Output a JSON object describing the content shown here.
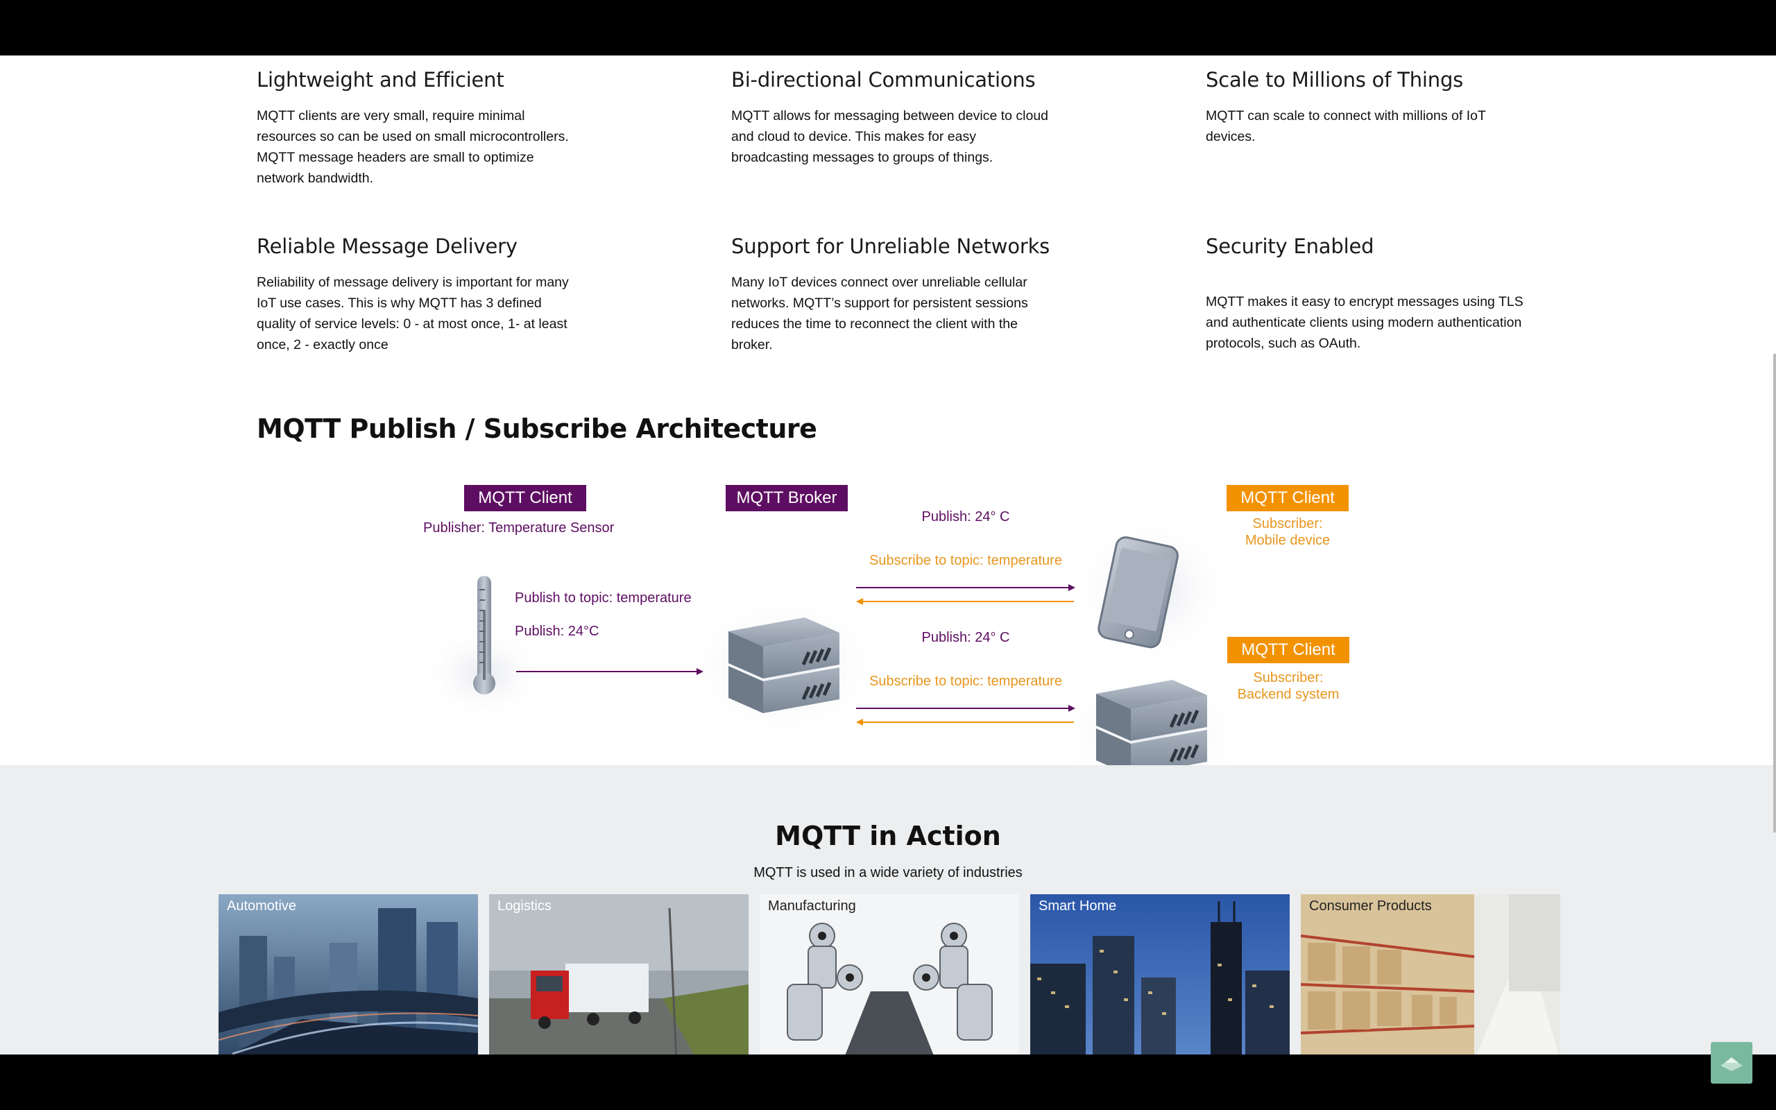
{
  "features": [
    {
      "title": "Lightweight and Efficient",
      "text": "MQTT clients are very small, require minimal resources so can be used on small microcontrollers. MQTT message headers are small to optimize network bandwidth."
    },
    {
      "title": "Bi-directional Communications",
      "text": "MQTT allows for messaging between device to cloud and cloud to device. This makes for easy broadcasting messages to groups of things."
    },
    {
      "title": "Scale to Millions of Things",
      "text": "MQTT can scale to connect with millions of IoT devices."
    },
    {
      "title": "Reliable Message Delivery",
      "text": "Reliability of message delivery is important for many IoT use cases. This is why MQTT has 3 defined quality of service levels: 0 - at most once, 1- at least once, 2 - exactly once"
    },
    {
      "title": "Support for Unreliable Networks",
      "text": "Many IoT devices connect over unreliable cellular networks. MQTT’s support for persistent sessions reduces the time to reconnect the client with the broker."
    },
    {
      "title": "Security Enabled",
      "text": "MQTT makes it easy to encrypt messages using TLS and authenticate clients using modern authentication protocols, such as OAuth."
    }
  ],
  "architecture": {
    "title": "MQTT Publish / Subscribe Architecture",
    "publisher_tag": "MQTT Client",
    "publisher_label": "Publisher: Temperature Sensor",
    "publish_topic": "Publish to topic: temperature",
    "publish_value": "Publish: 24°C",
    "broker_tag": "MQTT Broker",
    "top_publish": "Publish: 24° C",
    "top_subscribe": "Subscribe to topic: temperature",
    "bottom_publish": "Publish: 24° C",
    "bottom_subscribe": "Subscribe to topic: temperature",
    "mobile_tag": "MQTT Client",
    "mobile_sub_line1": "Subscriber:",
    "mobile_sub_line2": "Mobile device",
    "backend_tag": "MQTT Client",
    "backend_sub_line1": "Subscriber:",
    "backend_sub_line2": "Backend system"
  },
  "action": {
    "title": "MQTT in Action",
    "subtitle": "MQTT is used in a wide variety of industries",
    "tiles": [
      "Automotive",
      "Logistics",
      "Manufacturing",
      "Smart Home",
      "Consumer Products"
    ]
  },
  "colors": {
    "purple": "#5e0e62",
    "orange": "#f39200"
  },
  "icons": [
    "thermometer-icon",
    "server-icon",
    "smartphone-icon",
    "scroll-to-top-icon",
    "mouse-cursor-icon"
  ]
}
